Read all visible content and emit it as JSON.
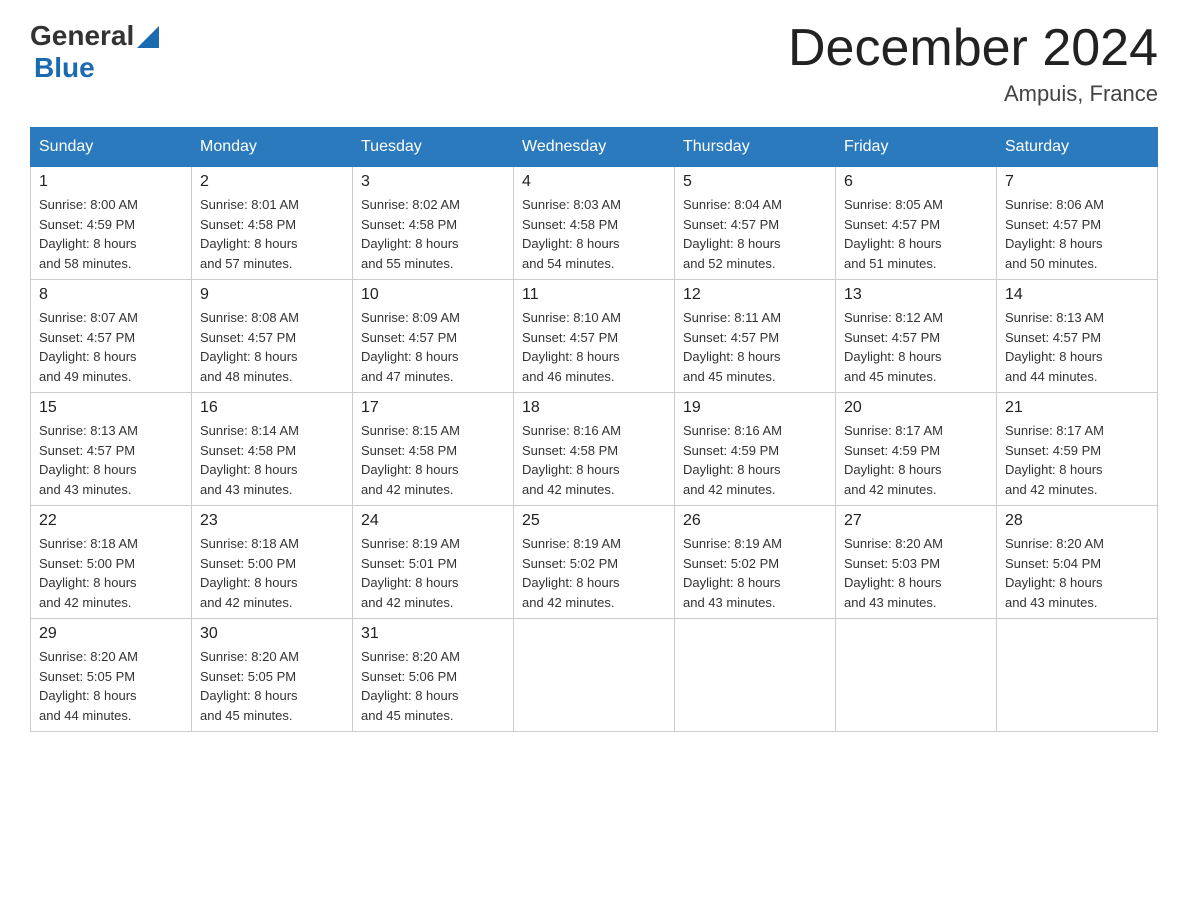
{
  "header": {
    "logo_general": "General",
    "logo_blue": "Blue",
    "month_title": "December 2024",
    "location": "Ampuis, France"
  },
  "weekdays": [
    "Sunday",
    "Monday",
    "Tuesday",
    "Wednesday",
    "Thursday",
    "Friday",
    "Saturday"
  ],
  "weeks": [
    [
      {
        "day": "1",
        "sunrise": "8:00 AM",
        "sunset": "4:59 PM",
        "daylight": "8 hours and 58 minutes."
      },
      {
        "day": "2",
        "sunrise": "8:01 AM",
        "sunset": "4:58 PM",
        "daylight": "8 hours and 57 minutes."
      },
      {
        "day": "3",
        "sunrise": "8:02 AM",
        "sunset": "4:58 PM",
        "daylight": "8 hours and 55 minutes."
      },
      {
        "day": "4",
        "sunrise": "8:03 AM",
        "sunset": "4:58 PM",
        "daylight": "8 hours and 54 minutes."
      },
      {
        "day": "5",
        "sunrise": "8:04 AM",
        "sunset": "4:57 PM",
        "daylight": "8 hours and 52 minutes."
      },
      {
        "day": "6",
        "sunrise": "8:05 AM",
        "sunset": "4:57 PM",
        "daylight": "8 hours and 51 minutes."
      },
      {
        "day": "7",
        "sunrise": "8:06 AM",
        "sunset": "4:57 PM",
        "daylight": "8 hours and 50 minutes."
      }
    ],
    [
      {
        "day": "8",
        "sunrise": "8:07 AM",
        "sunset": "4:57 PM",
        "daylight": "8 hours and 49 minutes."
      },
      {
        "day": "9",
        "sunrise": "8:08 AM",
        "sunset": "4:57 PM",
        "daylight": "8 hours and 48 minutes."
      },
      {
        "day": "10",
        "sunrise": "8:09 AM",
        "sunset": "4:57 PM",
        "daylight": "8 hours and 47 minutes."
      },
      {
        "day": "11",
        "sunrise": "8:10 AM",
        "sunset": "4:57 PM",
        "daylight": "8 hours and 46 minutes."
      },
      {
        "day": "12",
        "sunrise": "8:11 AM",
        "sunset": "4:57 PM",
        "daylight": "8 hours and 45 minutes."
      },
      {
        "day": "13",
        "sunrise": "8:12 AM",
        "sunset": "4:57 PM",
        "daylight": "8 hours and 45 minutes."
      },
      {
        "day": "14",
        "sunrise": "8:13 AM",
        "sunset": "4:57 PM",
        "daylight": "8 hours and 44 minutes."
      }
    ],
    [
      {
        "day": "15",
        "sunrise": "8:13 AM",
        "sunset": "4:57 PM",
        "daylight": "8 hours and 43 minutes."
      },
      {
        "day": "16",
        "sunrise": "8:14 AM",
        "sunset": "4:58 PM",
        "daylight": "8 hours and 43 minutes."
      },
      {
        "day": "17",
        "sunrise": "8:15 AM",
        "sunset": "4:58 PM",
        "daylight": "8 hours and 42 minutes."
      },
      {
        "day": "18",
        "sunrise": "8:16 AM",
        "sunset": "4:58 PM",
        "daylight": "8 hours and 42 minutes."
      },
      {
        "day": "19",
        "sunrise": "8:16 AM",
        "sunset": "4:59 PM",
        "daylight": "8 hours and 42 minutes."
      },
      {
        "day": "20",
        "sunrise": "8:17 AM",
        "sunset": "4:59 PM",
        "daylight": "8 hours and 42 minutes."
      },
      {
        "day": "21",
        "sunrise": "8:17 AM",
        "sunset": "4:59 PM",
        "daylight": "8 hours and 42 minutes."
      }
    ],
    [
      {
        "day": "22",
        "sunrise": "8:18 AM",
        "sunset": "5:00 PM",
        "daylight": "8 hours and 42 minutes."
      },
      {
        "day": "23",
        "sunrise": "8:18 AM",
        "sunset": "5:00 PM",
        "daylight": "8 hours and 42 minutes."
      },
      {
        "day": "24",
        "sunrise": "8:19 AM",
        "sunset": "5:01 PM",
        "daylight": "8 hours and 42 minutes."
      },
      {
        "day": "25",
        "sunrise": "8:19 AM",
        "sunset": "5:02 PM",
        "daylight": "8 hours and 42 minutes."
      },
      {
        "day": "26",
        "sunrise": "8:19 AM",
        "sunset": "5:02 PM",
        "daylight": "8 hours and 43 minutes."
      },
      {
        "day": "27",
        "sunrise": "8:20 AM",
        "sunset": "5:03 PM",
        "daylight": "8 hours and 43 minutes."
      },
      {
        "day": "28",
        "sunrise": "8:20 AM",
        "sunset": "5:04 PM",
        "daylight": "8 hours and 43 minutes."
      }
    ],
    [
      {
        "day": "29",
        "sunrise": "8:20 AM",
        "sunset": "5:05 PM",
        "daylight": "8 hours and 44 minutes."
      },
      {
        "day": "30",
        "sunrise": "8:20 AM",
        "sunset": "5:05 PM",
        "daylight": "8 hours and 45 minutes."
      },
      {
        "day": "31",
        "sunrise": "8:20 AM",
        "sunset": "5:06 PM",
        "daylight": "8 hours and 45 minutes."
      },
      null,
      null,
      null,
      null
    ]
  ],
  "labels": {
    "sunrise": "Sunrise:",
    "sunset": "Sunset:",
    "daylight": "Daylight:"
  }
}
